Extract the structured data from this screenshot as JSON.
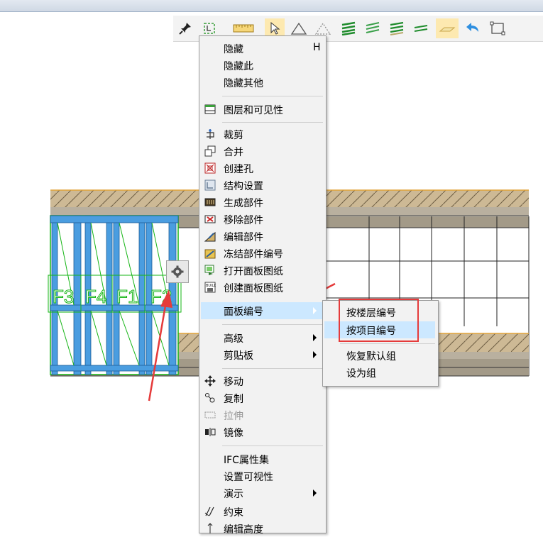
{
  "menu": {
    "hide": "隐藏",
    "hide_shortcut": "H",
    "hide_this": "隐藏此",
    "hide_others": "隐藏其他",
    "layers_visibility": "图层和可见性",
    "trim": "裁剪",
    "merge": "合并",
    "create_hole": "创建孔",
    "structure_settings": "结构设置",
    "generate_parts": "生成部件",
    "remove_parts": "移除部件",
    "edit_parts": "编辑部件",
    "freeze_part_numbers": "冻结部件编号",
    "open_panel_drawing": "打开面板图纸",
    "create_panel_drawing": "创建面板图纸",
    "panel_numbering": "面板编号",
    "advanced": "高级",
    "clipboard": "剪贴板",
    "move": "移动",
    "copy": "复制",
    "stretch": "拉伸",
    "mirror": "镜像",
    "ifc_property_set": "IFC属性集",
    "set_visibility": "设置可视性",
    "demo": "演示",
    "constraint": "约束",
    "edit_height": "编辑高度"
  },
  "submenu": {
    "by_floor": "按楼层编号",
    "by_project": "按项目编号",
    "restore_default_group": "恢复默认组",
    "set_as_group": "设为组"
  },
  "panels": {
    "labels": [
      "F3",
      "F4",
      "F1",
      "F2"
    ]
  },
  "toolbar": {
    "icons": [
      "pin-icon",
      "select-region-icon",
      "ruler-icon",
      "pointer-icon",
      "triangle-icon",
      "triangle-dotted-icon",
      "layers-green-icon",
      "layers-green-alt-icon",
      "layers-green-stack-icon",
      "plane-icon",
      "plane-highlight-icon",
      "undo-icon",
      "frame-icon"
    ]
  },
  "colors": {
    "menu_highlight": "#cce8ff",
    "annotation_red": "#e53b3b",
    "panel_blue": "#4a9de0",
    "panel_label_green": "#16b516",
    "hatch": "#c8b28a"
  }
}
